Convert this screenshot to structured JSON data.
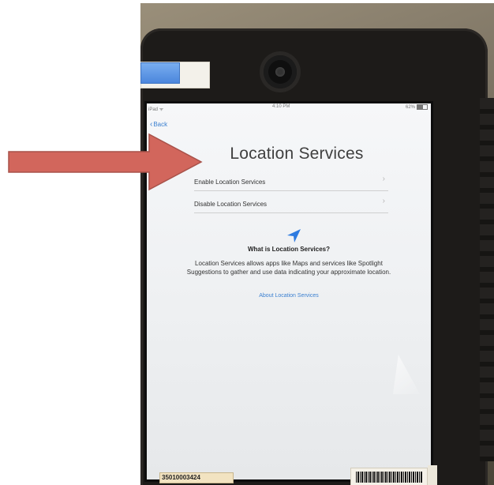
{
  "status": {
    "carrier": "iPad",
    "time": "4:10 PM",
    "battery": "62%"
  },
  "nav": {
    "back_label": "Back"
  },
  "screen": {
    "title": "Location Services",
    "options": [
      {
        "label": "Enable Location Services"
      },
      {
        "label": "Disable Location Services"
      }
    ],
    "info_title": "What is Location Services?",
    "info_body": "Location Services allows apps like Maps and services like Spotlight Suggestions to gather and use data indicating your approximate location.",
    "link_label": "About Location Services"
  },
  "asset_tag": "35010003424",
  "colors": {
    "pointer_arrow": "#d2665c",
    "link": "#3a7fd0",
    "tape": "#5a95e4"
  },
  "icons": [
    "location-arrow-icon",
    "chevron-left-icon",
    "chevron-right-icon",
    "battery-icon",
    "wifi-icon"
  ]
}
